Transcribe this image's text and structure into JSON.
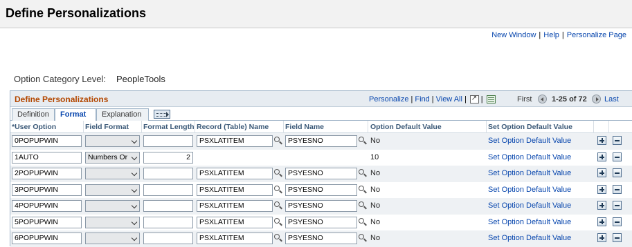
{
  "page": {
    "title": "Define Personalizations"
  },
  "util_links": {
    "new_window": "New Window",
    "help": "Help",
    "personalize_page": "Personalize Page",
    "separator": "|"
  },
  "option_category": {
    "label": "Option Category Level:",
    "value": "PeopleTools"
  },
  "grid": {
    "title": "Define Personalizations",
    "tools": {
      "personalize": "Personalize",
      "find": "Find",
      "view_all": "View All",
      "separator": "|"
    },
    "nav": {
      "first": "First",
      "range": "1-25 of 72",
      "last": "Last"
    },
    "tabs": [
      "Definition",
      "Format",
      "Explanation"
    ],
    "active_tab": "Format",
    "columns": [
      "*User Option",
      "Field Format",
      "Format Length",
      "Record (Table) Name",
      "Field Name",
      "Option Default Value",
      "Set Option Default Value"
    ],
    "rows": [
      {
        "user_option": "0POPUPWIN",
        "field_format": "",
        "format_length": "",
        "record_name": "PSXLATITEM",
        "field_name": "PSYESNO",
        "default_value": "No",
        "set_default": "Set Option Default Value"
      },
      {
        "user_option": "1AUTO",
        "field_format": "Numbers Or",
        "format_length": "2",
        "record_name": "",
        "field_name": "",
        "default_value": "10",
        "set_default": "Set Option Default Value"
      },
      {
        "user_option": "2POPUPWIN",
        "field_format": "",
        "format_length": "",
        "record_name": "PSXLATITEM",
        "field_name": "PSYESNO",
        "default_value": "No",
        "set_default": "Set Option Default Value"
      },
      {
        "user_option": "3POPUPWIN",
        "field_format": "",
        "format_length": "",
        "record_name": "PSXLATITEM",
        "field_name": "PSYESNO",
        "default_value": "No",
        "set_default": "Set Option Default Value"
      },
      {
        "user_option": "4POPUPWIN",
        "field_format": "",
        "format_length": "",
        "record_name": "PSXLATITEM",
        "field_name": "PSYESNO",
        "default_value": "No",
        "set_default": "Set Option Default Value"
      },
      {
        "user_option": "5POPUPWIN",
        "field_format": "",
        "format_length": "",
        "record_name": "PSXLATITEM",
        "field_name": "PSYESNO",
        "default_value": "No",
        "set_default": "Set Option Default Value"
      },
      {
        "user_option": "6POPUPWIN",
        "field_format": "",
        "format_length": "",
        "record_name": "PSXLATITEM",
        "field_name": "PSYESNO",
        "default_value": "No",
        "set_default": "Set Option Default Value"
      }
    ]
  },
  "colors": {
    "grid_title": "#b34700",
    "link": "#0645ad",
    "header_bg": "#f2f2f2",
    "grid_header_bg": "#e7ecf1"
  },
  "icons": {
    "zoom": "zoom-icon",
    "download": "excel-download-icon",
    "prev": "previous-arrow-icon",
    "next": "next-arrow-icon",
    "lookup": "lookup-icon",
    "add_row": "add-row-icon",
    "delete_row": "delete-row-icon",
    "show_all_columns": "show-all-columns-icon"
  }
}
